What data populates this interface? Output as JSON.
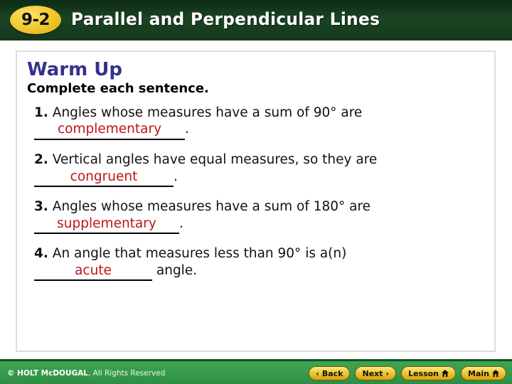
{
  "header": {
    "badge": "9-2",
    "title": "Parallel and Perpendicular Lines",
    "bg_color": "#1b4423",
    "badge_color": "#f5cc33"
  },
  "panel": {
    "warmup_title": "Warm Up",
    "warmup_instruction": "Complete each sentence.",
    "answer_color": "#c01414",
    "title_color": "#33338c",
    "questions": [
      {
        "number": "1.",
        "prompt": "Angles whose measures have a sum of 90° are",
        "answer": "complementary",
        "suffix": "."
      },
      {
        "number": "2.",
        "prompt": "Vertical angles have equal measures, so they are",
        "answer": "congruent",
        "suffix": "."
      },
      {
        "number": "3.",
        "prompt": "Angles whose measures have a sum of 180° are",
        "answer": "supplementary",
        "suffix": "."
      },
      {
        "number": "4.",
        "prompt": "An angle that measures less than 90° is a(n)",
        "answer": "acute",
        "suffix": " angle."
      }
    ]
  },
  "footer": {
    "copyright_strong": "© HOLT McDOUGAL",
    "copyright_rest": ", All Rights Reserved",
    "bg_color": "#35994a",
    "buttons": [
      {
        "label": "Back",
        "icon": "chevron-left-icon",
        "glyph": "‹",
        "icon_side": "left"
      },
      {
        "label": "Next",
        "icon": "chevron-right-icon",
        "glyph": "›",
        "icon_side": "right"
      },
      {
        "label": "Lesson",
        "icon": "home-icon",
        "glyph": "home",
        "icon_side": "right"
      },
      {
        "label": "Main",
        "icon": "home-icon",
        "glyph": "home",
        "icon_side": "right"
      }
    ]
  }
}
